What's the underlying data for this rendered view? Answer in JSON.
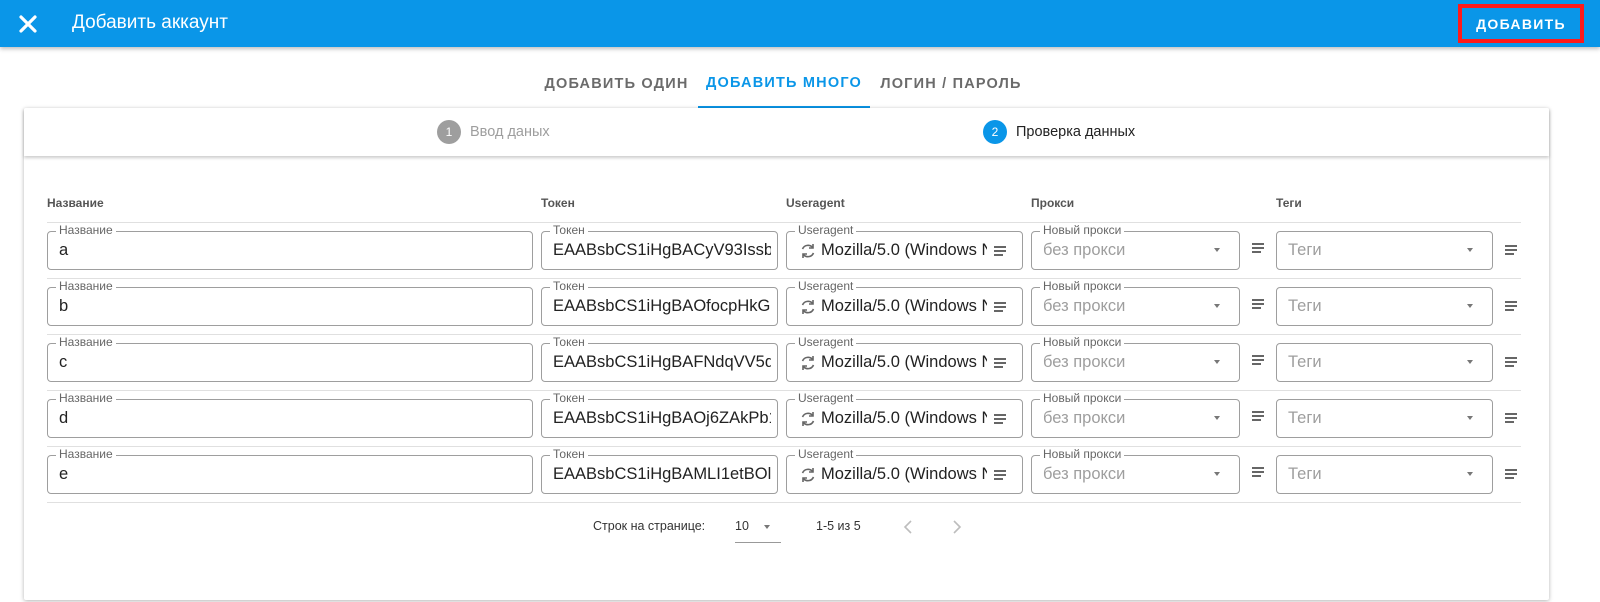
{
  "topbar": {
    "title": "Добавить аккаунт",
    "add_label": "ДОБАВИТЬ",
    "bg_color": "#0a96e8",
    "highlight_color": "#ff1a1a"
  },
  "tabs": [
    {
      "label": "ДОБАВИТЬ ОДИН",
      "active": false
    },
    {
      "label": "ДОБАВИТЬ МНОГО",
      "active": true
    },
    {
      "label": "ЛОГИН / ПАРОЛЬ",
      "active": false
    }
  ],
  "stepper": [
    {
      "num": "1",
      "label": "Ввод даных",
      "active": false
    },
    {
      "num": "2",
      "label": "Проверка данных",
      "active": true
    }
  ],
  "table": {
    "headers": {
      "name": "Название",
      "token": "Токен",
      "useragent": "Useragent",
      "proxy": "Прокси",
      "tags": "Теги"
    },
    "field_labels": {
      "name": "Название",
      "token": "Токен",
      "useragent": "Useragent",
      "proxy": "Новый прокси"
    },
    "rows": [
      {
        "name": "a",
        "token": "EAABsbCS1iHgBACyV93IssbK",
        "useragent": "Mozilla/5.0 (Windows N",
        "proxy": "без прокси",
        "tags": "Теги"
      },
      {
        "name": "b",
        "token": "EAABsbCS1iHgBAOfocpHkGpr",
        "useragent": "Mozilla/5.0 (Windows N",
        "proxy": "без прокси",
        "tags": "Теги"
      },
      {
        "name": "c",
        "token": "EAABsbCS1iHgBAFNdqVV5d5",
        "useragent": "Mozilla/5.0 (Windows N",
        "proxy": "без прокси",
        "tags": "Теги"
      },
      {
        "name": "d",
        "token": "EAABsbCS1iHgBAOj6ZAkPb10",
        "useragent": "Mozilla/5.0 (Windows N",
        "proxy": "без прокси",
        "tags": "Теги"
      },
      {
        "name": "e",
        "token": "EAABsbCS1iHgBAMLI1etBOlO",
        "useragent": "Mozilla/5.0 (Windows N",
        "proxy": "без прокси",
        "tags": "Теги"
      }
    ]
  },
  "pagination": {
    "rows_per_page_label": "Строк на странице:",
    "rows_per_page": "10",
    "range": "1-5 из 5"
  },
  "icons": {
    "close": "close-icon",
    "refresh": "refresh-icon",
    "menu": "menu-lines-icon",
    "dropdown": "dropdown-caret-icon",
    "prev": "chevron-left-icon",
    "next": "chevron-right-icon"
  }
}
